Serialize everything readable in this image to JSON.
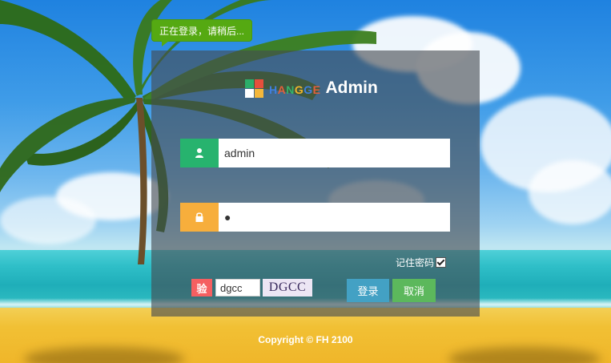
{
  "tooltip": {
    "text": "正在登录，请稍后..."
  },
  "logo": {
    "brand_letters": [
      {
        "ch": "H",
        "color": "#3f7fe0"
      },
      {
        "ch": "A",
        "color": "#e25f3c"
      },
      {
        "ch": "N",
        "color": "#35b36b"
      },
      {
        "ch": "G",
        "color": "#f0b52b"
      },
      {
        "ch": "G",
        "color": "#3f7fe0"
      },
      {
        "ch": "E",
        "color": "#e25f3c"
      }
    ],
    "grid_colors": [
      "#2cae6a",
      "#e54f3c",
      "#ffffff",
      "#f4b73a"
    ],
    "title": "Admin"
  },
  "form": {
    "username_value": "admin",
    "password_value": "●",
    "username_icon": "user-icon",
    "password_icon": "lock-icon",
    "remember_label": "记住密码",
    "remember_checked": true,
    "captcha_tag": "验",
    "captcha_input_value": "dgcc",
    "captcha_image_text": "DGCC",
    "login_button": "登录",
    "cancel_button": "取消"
  },
  "colors": {
    "user_icon_bg": "#27b36e",
    "lock_icon_bg": "#f7ae3c",
    "login_btn": "#43a1c4",
    "cancel_btn": "#5cb85c",
    "tooltip_bg": "#55a912"
  },
  "footer": {
    "copyright": "Copyright © FH 2100"
  }
}
